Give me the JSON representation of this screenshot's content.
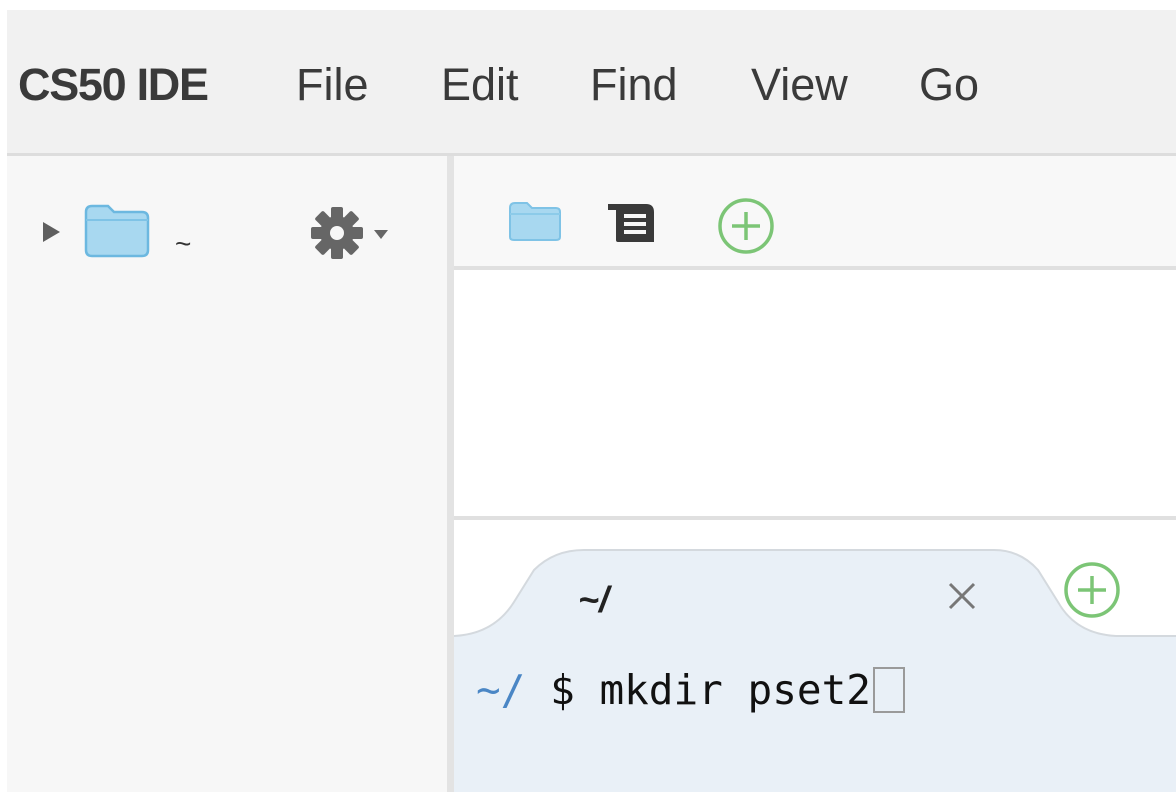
{
  "menubar": {
    "brand": "CS50 IDE",
    "items": [
      "File",
      "Edit",
      "Find",
      "View",
      "Go"
    ]
  },
  "file_tree": {
    "root_label": "~",
    "icons": [
      "triangle-right-icon",
      "folder-icon",
      "gear-icon",
      "caret-down-icon"
    ]
  },
  "editor_toolbar": {
    "icons": [
      "folder-icon",
      "file-list-icon",
      "plus-circle-icon"
    ]
  },
  "terminal": {
    "tab_title": "~/",
    "close_glyph": "×",
    "prompt_path": "~/",
    "prompt_symbol": "$",
    "command": "mkdir pset2"
  },
  "colors": {
    "menubar_bg": "#f1f1f1",
    "folder_blue": "#a8d8f0",
    "add_green": "#7cc576",
    "terminal_bg": "#e9f0f7",
    "path_blue": "#4a86c5"
  }
}
